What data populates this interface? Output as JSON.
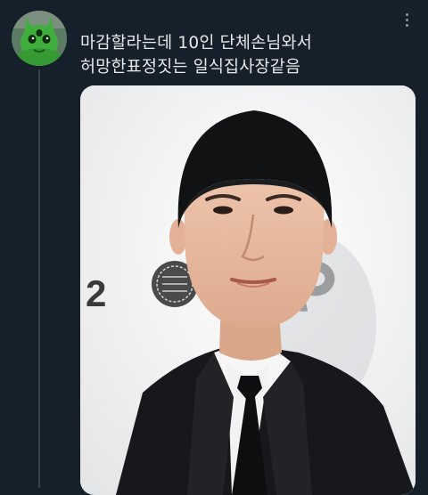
{
  "tweet": {
    "text_lines": [
      "마감할라는데 10인 단체손님와서",
      "허망한표정짓는 일식집사장같음"
    ],
    "backdrop_number": "2",
    "colors": {
      "background": "#15202b",
      "text": "#e7e9ea",
      "thread_line": "#38444d",
      "icon": "#8b98a5"
    }
  },
  "icons": {
    "more": "more-horizontal-icon"
  }
}
